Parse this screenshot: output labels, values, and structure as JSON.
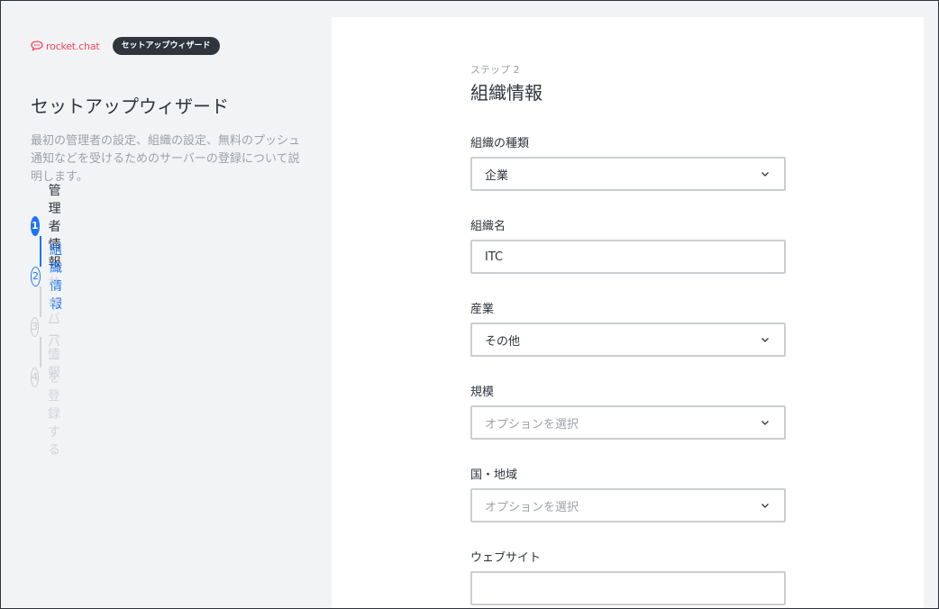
{
  "brand": {
    "logo_text": "rocket.chat",
    "tag": "セットアップウィザード",
    "logo_color": "#f5455c"
  },
  "sidebar": {
    "title": "セットアップウィザード",
    "description": "最初の管理者の設定、組織の設定、無料のプッシュ通知などを受けるためのサーバーの登録について説明します。",
    "steps": [
      {
        "num": "1",
        "label": "管理者情報",
        "state": "done"
      },
      {
        "num": "2",
        "label": "組織情報",
        "state": "current"
      },
      {
        "num": "3",
        "label": "サーバー情報",
        "state": "pending"
      },
      {
        "num": "4",
        "label": "サーバーを登録する",
        "state": "pending"
      }
    ]
  },
  "form": {
    "step_label": "ステップ 2",
    "title": "組織情報",
    "fields": {
      "org_type": {
        "label": "組織の種類",
        "value": "企業"
      },
      "org_name": {
        "label": "組織名",
        "value": "ITC"
      },
      "industry": {
        "label": "産業",
        "value": "その他"
      },
      "size": {
        "label": "規模",
        "value": "オプションを選択"
      },
      "country": {
        "label": "国・地域",
        "value": "オプションを選択"
      },
      "website": {
        "label": "ウェブサイト",
        "value": ""
      }
    }
  },
  "colors": {
    "accent": "#1d74f5",
    "sidebar_bg": "#f2f3f5",
    "text": "#2f343d",
    "muted": "#9ea2a8"
  }
}
